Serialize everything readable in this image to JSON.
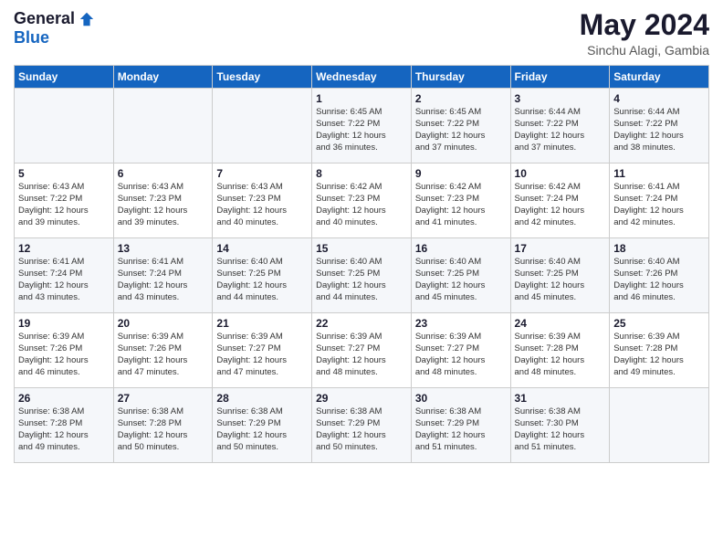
{
  "header": {
    "logo_general": "General",
    "logo_blue": "Blue",
    "month": "May 2024",
    "location": "Sinchu Alagi, Gambia"
  },
  "days_of_week": [
    "Sunday",
    "Monday",
    "Tuesday",
    "Wednesday",
    "Thursday",
    "Friday",
    "Saturday"
  ],
  "weeks": [
    [
      {
        "day": "",
        "info": ""
      },
      {
        "day": "",
        "info": ""
      },
      {
        "day": "",
        "info": ""
      },
      {
        "day": "1",
        "info": "Sunrise: 6:45 AM\nSunset: 7:22 PM\nDaylight: 12 hours\nand 36 minutes."
      },
      {
        "day": "2",
        "info": "Sunrise: 6:45 AM\nSunset: 7:22 PM\nDaylight: 12 hours\nand 37 minutes."
      },
      {
        "day": "3",
        "info": "Sunrise: 6:44 AM\nSunset: 7:22 PM\nDaylight: 12 hours\nand 37 minutes."
      },
      {
        "day": "4",
        "info": "Sunrise: 6:44 AM\nSunset: 7:22 PM\nDaylight: 12 hours\nand 38 minutes."
      }
    ],
    [
      {
        "day": "5",
        "info": "Sunrise: 6:43 AM\nSunset: 7:22 PM\nDaylight: 12 hours\nand 39 minutes."
      },
      {
        "day": "6",
        "info": "Sunrise: 6:43 AM\nSunset: 7:23 PM\nDaylight: 12 hours\nand 39 minutes."
      },
      {
        "day": "7",
        "info": "Sunrise: 6:43 AM\nSunset: 7:23 PM\nDaylight: 12 hours\nand 40 minutes."
      },
      {
        "day": "8",
        "info": "Sunrise: 6:42 AM\nSunset: 7:23 PM\nDaylight: 12 hours\nand 40 minutes."
      },
      {
        "day": "9",
        "info": "Sunrise: 6:42 AM\nSunset: 7:23 PM\nDaylight: 12 hours\nand 41 minutes."
      },
      {
        "day": "10",
        "info": "Sunrise: 6:42 AM\nSunset: 7:24 PM\nDaylight: 12 hours\nand 42 minutes."
      },
      {
        "day": "11",
        "info": "Sunrise: 6:41 AM\nSunset: 7:24 PM\nDaylight: 12 hours\nand 42 minutes."
      }
    ],
    [
      {
        "day": "12",
        "info": "Sunrise: 6:41 AM\nSunset: 7:24 PM\nDaylight: 12 hours\nand 43 minutes."
      },
      {
        "day": "13",
        "info": "Sunrise: 6:41 AM\nSunset: 7:24 PM\nDaylight: 12 hours\nand 43 minutes."
      },
      {
        "day": "14",
        "info": "Sunrise: 6:40 AM\nSunset: 7:25 PM\nDaylight: 12 hours\nand 44 minutes."
      },
      {
        "day": "15",
        "info": "Sunrise: 6:40 AM\nSunset: 7:25 PM\nDaylight: 12 hours\nand 44 minutes."
      },
      {
        "day": "16",
        "info": "Sunrise: 6:40 AM\nSunset: 7:25 PM\nDaylight: 12 hours\nand 45 minutes."
      },
      {
        "day": "17",
        "info": "Sunrise: 6:40 AM\nSunset: 7:25 PM\nDaylight: 12 hours\nand 45 minutes."
      },
      {
        "day": "18",
        "info": "Sunrise: 6:40 AM\nSunset: 7:26 PM\nDaylight: 12 hours\nand 46 minutes."
      }
    ],
    [
      {
        "day": "19",
        "info": "Sunrise: 6:39 AM\nSunset: 7:26 PM\nDaylight: 12 hours\nand 46 minutes."
      },
      {
        "day": "20",
        "info": "Sunrise: 6:39 AM\nSunset: 7:26 PM\nDaylight: 12 hours\nand 47 minutes."
      },
      {
        "day": "21",
        "info": "Sunrise: 6:39 AM\nSunset: 7:27 PM\nDaylight: 12 hours\nand 47 minutes."
      },
      {
        "day": "22",
        "info": "Sunrise: 6:39 AM\nSunset: 7:27 PM\nDaylight: 12 hours\nand 48 minutes."
      },
      {
        "day": "23",
        "info": "Sunrise: 6:39 AM\nSunset: 7:27 PM\nDaylight: 12 hours\nand 48 minutes."
      },
      {
        "day": "24",
        "info": "Sunrise: 6:39 AM\nSunset: 7:28 PM\nDaylight: 12 hours\nand 48 minutes."
      },
      {
        "day": "25",
        "info": "Sunrise: 6:39 AM\nSunset: 7:28 PM\nDaylight: 12 hours\nand 49 minutes."
      }
    ],
    [
      {
        "day": "26",
        "info": "Sunrise: 6:38 AM\nSunset: 7:28 PM\nDaylight: 12 hours\nand 49 minutes."
      },
      {
        "day": "27",
        "info": "Sunrise: 6:38 AM\nSunset: 7:28 PM\nDaylight: 12 hours\nand 50 minutes."
      },
      {
        "day": "28",
        "info": "Sunrise: 6:38 AM\nSunset: 7:29 PM\nDaylight: 12 hours\nand 50 minutes."
      },
      {
        "day": "29",
        "info": "Sunrise: 6:38 AM\nSunset: 7:29 PM\nDaylight: 12 hours\nand 50 minutes."
      },
      {
        "day": "30",
        "info": "Sunrise: 6:38 AM\nSunset: 7:29 PM\nDaylight: 12 hours\nand 51 minutes."
      },
      {
        "day": "31",
        "info": "Sunrise: 6:38 AM\nSunset: 7:30 PM\nDaylight: 12 hours\nand 51 minutes."
      },
      {
        "day": "",
        "info": ""
      }
    ]
  ]
}
